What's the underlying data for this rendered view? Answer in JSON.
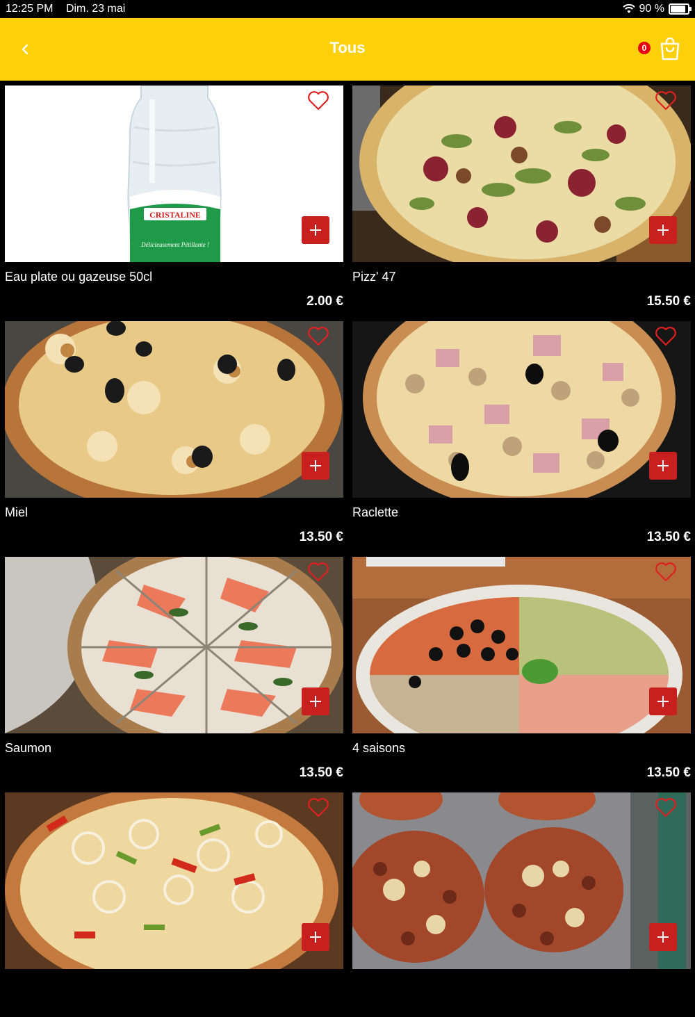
{
  "status_bar": {
    "time": "12:25 PM",
    "date": "Dim. 23 mai",
    "battery": "90 %"
  },
  "header": {
    "title": "Tous",
    "cart_count": "0"
  },
  "colors": {
    "header_bg": "#fdd009",
    "add_button": "#c8201e",
    "badge": "#e30613",
    "favorite": "#e02020"
  },
  "products": [
    {
      "name": "Eau plate ou gazeuse 50cl",
      "price": "2.00 €",
      "image": "cristaline-bottle"
    },
    {
      "name": "Pizz' 47",
      "price": "15.50 €",
      "image": "pizza-fig-salad"
    },
    {
      "name": "Miel",
      "price": "13.50 €",
      "image": "pizza-goat-cheese"
    },
    {
      "name": "Raclette",
      "price": "13.50 €",
      "image": "pizza-ham-mushroom"
    },
    {
      "name": "Saumon",
      "price": "13.50 €",
      "image": "pizza-salmon"
    },
    {
      "name": "4 saisons",
      "price": "13.50 €",
      "image": "pizza-four-seasons"
    },
    {
      "name": "",
      "price": "",
      "image": "pizza-peppers-onions"
    },
    {
      "name": "",
      "price": "",
      "image": "pizza-bolognese"
    }
  ],
  "bottle_label": {
    "brand": "CRISTALINE",
    "tagline": "Délicieusement Pétillante !"
  }
}
